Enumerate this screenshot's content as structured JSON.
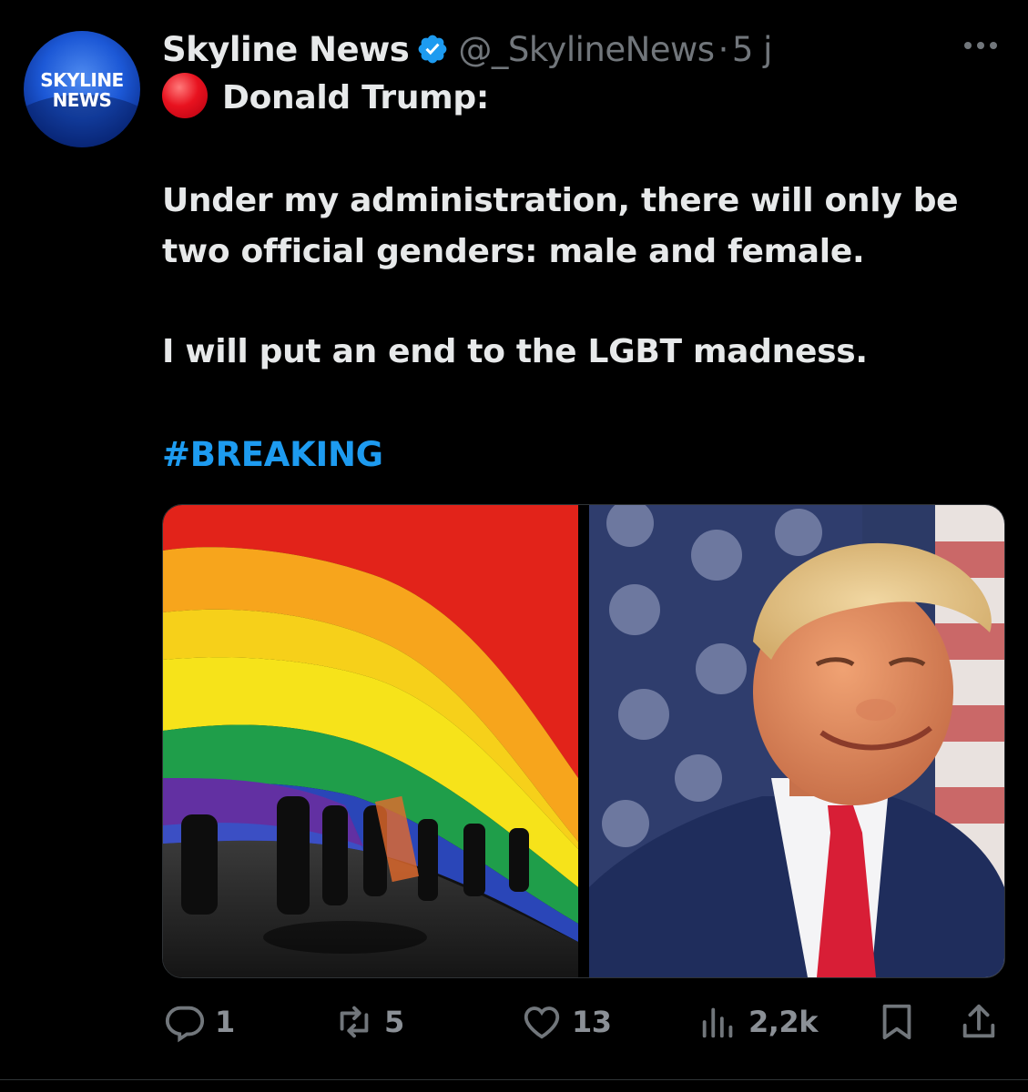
{
  "author": {
    "avatar_text": "SKYLINE\nNEWS",
    "display_name": "Skyline News",
    "handle": "@_SkylineNews",
    "separator": "·",
    "time": "5 j"
  },
  "body": {
    "line1": "Donald Trump:",
    "line2": "Under my administration, there will only be",
    "line3": "two official genders: male and female.",
    "line4": "I will put an end to the LGBT madness.",
    "hashtag": "#BREAKING"
  },
  "actions": {
    "replies": "1",
    "reposts": "5",
    "likes": "13",
    "views": "2,2k"
  },
  "icons": {
    "verified": "verified-badge-icon",
    "more": "more-dots-icon",
    "reply": "reply-bubble-icon",
    "repost": "repost-arrows-icon",
    "like": "heart-icon",
    "views": "bar-chart-icon",
    "bookmark": "bookmark-icon",
    "share": "share-upload-icon",
    "red_circle": "red-circle-emoji"
  },
  "colors": {
    "background": "#000000",
    "text": "#e7e9ea",
    "muted": "#71767b",
    "link": "#1d9bf0",
    "verified": "#1d9bf0"
  }
}
